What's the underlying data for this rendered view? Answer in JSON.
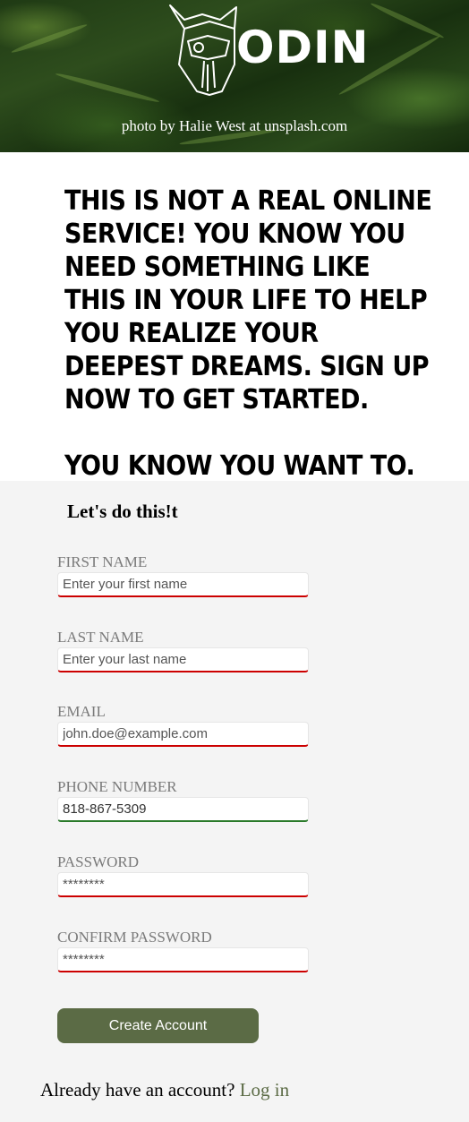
{
  "header": {
    "logo_text": "ODIN",
    "photo_credit": "photo by Halie West at unsplash.com"
  },
  "pitch": {
    "paragraph_1": "This is not a real online service! You know you need something like this in your life to help you realize your deepest dreams. Sign up now to get started.",
    "paragraph_2": "You know you want to."
  },
  "form": {
    "heading": "Let's do this!t",
    "first_name": {
      "label": "FIRST NAME",
      "placeholder": "Enter your first name",
      "value": ""
    },
    "last_name": {
      "label": "LAST NAME",
      "placeholder": "Enter your last name",
      "value": ""
    },
    "email": {
      "label": "EMAIL",
      "placeholder": "john.doe@example.com",
      "value": ""
    },
    "phone": {
      "label": "PHONE NUMBER",
      "placeholder": "",
      "value": "818-867-5309"
    },
    "password": {
      "label": "PASSWORD",
      "placeholder": "********",
      "value": ""
    },
    "confirm_password": {
      "label": "CONFIRM PASSWORD",
      "placeholder": "********",
      "value": ""
    },
    "submit_label": "Create Account"
  },
  "footer": {
    "prompt": "Already have an account?",
    "login_link": "Log in"
  },
  "colors": {
    "accent": "#5b6b45",
    "invalid": "#cc0000",
    "valid": "#2a7a2a"
  }
}
